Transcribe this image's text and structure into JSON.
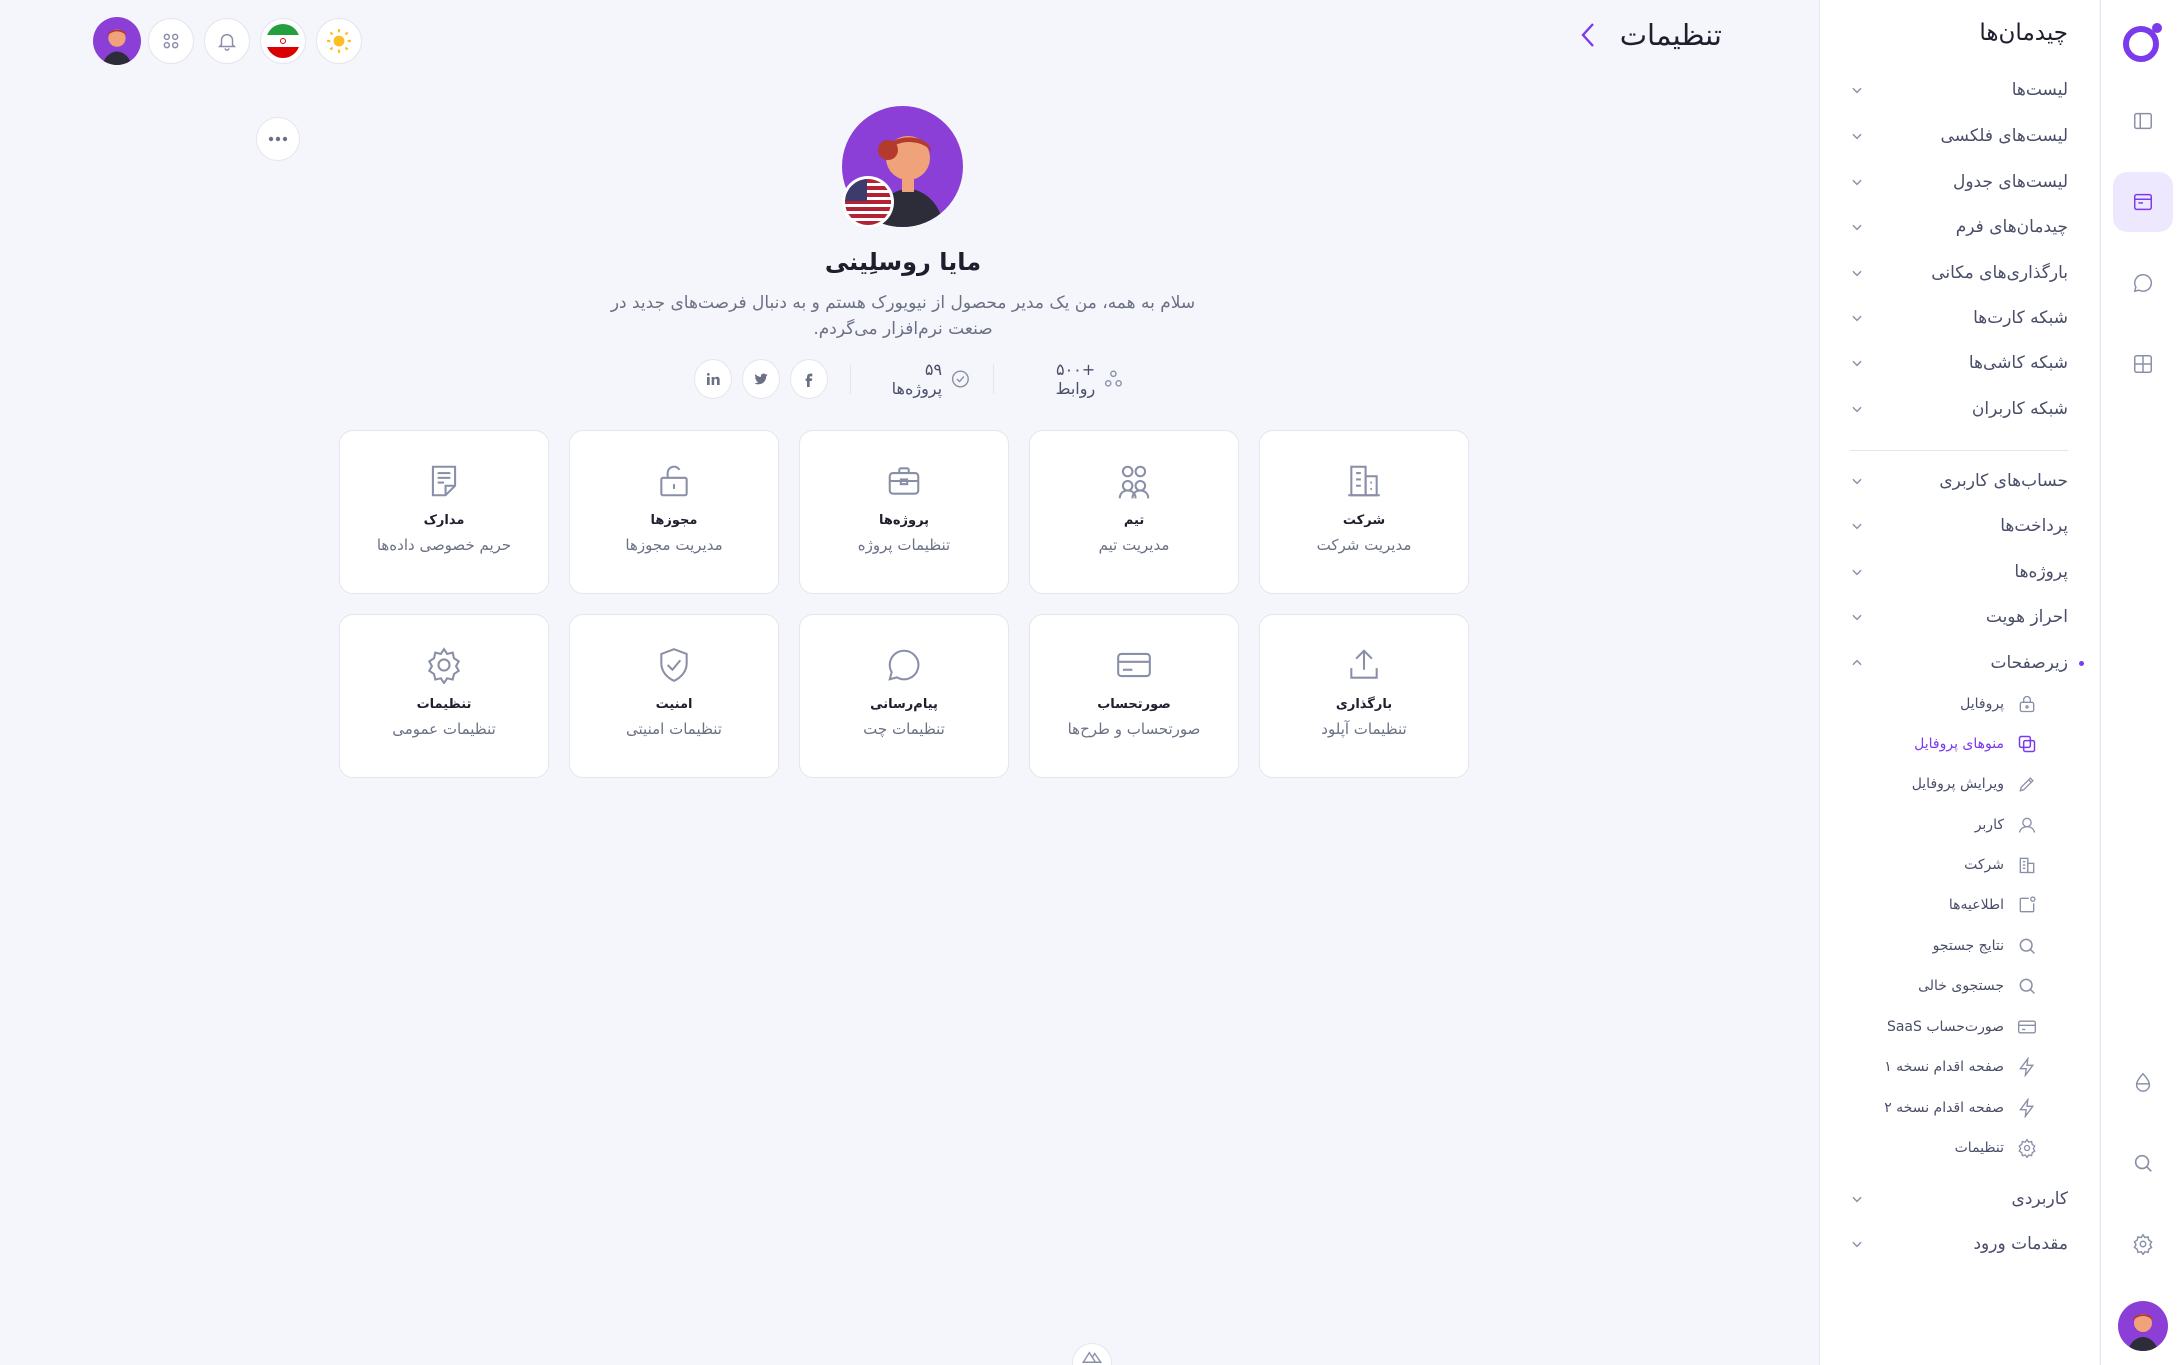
{
  "header": {
    "title": "تنظیمات",
    "back_icon": "chevron-left-icon",
    "actions": [
      "sun-icon",
      "iran-flag",
      "bell-icon",
      "apps-icon",
      "user-avatar"
    ]
  },
  "profile": {
    "name": "مایا روسلِینی",
    "bio": "سلام به همه، من یک مدیر محصول از نیویورک هستم و به دنبال فرصت‌های جدید در صنعت نرم‌افزار می‌گردم.",
    "connections": "+۵۰۰ روابط",
    "projects": "۵۹ پروژه‌ها",
    "social": [
      "linkedin-icon",
      "twitter-icon",
      "facebook-icon"
    ]
  },
  "cards": [
    {
      "title": "شرکت",
      "subtitle": "مدیریت شرکت",
      "icon": "building-icon"
    },
    {
      "title": "تیم",
      "subtitle": "مدیریت تیم",
      "icon": "team-icon"
    },
    {
      "title": "پروژه‌ها",
      "subtitle": "تنظیمات پروژه",
      "icon": "briefcase-icon"
    },
    {
      "title": "مجوزها",
      "subtitle": "مدیریت مجوزها",
      "icon": "unlock-icon"
    },
    {
      "title": "مدارک",
      "subtitle": "حریم خصوصی داده‌ها",
      "icon": "document-icon"
    },
    {
      "title": "بارگذاری",
      "subtitle": "تنظیمات آپلود",
      "icon": "upload-icon"
    },
    {
      "title": "صورتحساب",
      "subtitle": "صورتحساب و طرح‌ها",
      "icon": "credit-card-icon"
    },
    {
      "title": "پیام‌رسانی",
      "subtitle": "تنظیمات چت",
      "icon": "chat-icon"
    },
    {
      "title": "امنیت",
      "subtitle": "تنظیمات امنیتی",
      "icon": "shield-icon"
    },
    {
      "title": "تنظیمات",
      "subtitle": "تنظیمات عمومی",
      "icon": "gear-icon"
    }
  ],
  "sidebar": {
    "title": "چیدمان‌ها",
    "groups": [
      "لیست‌ها",
      "لیست‌های فلکسی",
      "لیست‌های جدول",
      "چیدمان‌های فرم",
      "بارگذاری‌های مکانی",
      "شبکه کارت‌ها",
      "شبکه کاشی‌ها",
      "شبکه کاربران"
    ],
    "sections": [
      "حساب‌های کاربری",
      "پرداخت‌ها",
      "پروژه‌ها",
      "احراز هویت",
      "زیرصفحات"
    ],
    "subpages": [
      {
        "label": "پروفایل",
        "icon": "lock-icon"
      },
      {
        "label": "منوهای پروفایل",
        "icon": "copy-icon",
        "active": true
      },
      {
        "label": "ویرایش پروفایل",
        "icon": "pencil-icon"
      },
      {
        "label": "کاربر",
        "icon": "user-icon"
      },
      {
        "label": "شرکت",
        "icon": "building-icon"
      },
      {
        "label": "اطلاعیه‌ها",
        "icon": "notification-icon"
      },
      {
        "label": "نتایج جستجو",
        "icon": "search-icon"
      },
      {
        "label": "جستجوی خالی",
        "icon": "search-icon"
      },
      {
        "label": "صورت‌حساب SaaS",
        "icon": "credit-card-icon"
      },
      {
        "label": "صفحه اقدام نسخه ۱",
        "icon": "bolt-icon"
      },
      {
        "label": "صفحه اقدام نسخه ۲",
        "icon": "bolt-icon"
      },
      {
        "label": "تنظیمات",
        "icon": "gear-icon"
      }
    ],
    "bottom": [
      "کاربردی",
      "مقدمات ورود"
    ]
  },
  "colors": {
    "accent": "#7c3aed",
    "background": "#f4f6fb",
    "card": "#ffffff",
    "muted": "#6b7085",
    "icon": "#8a8fa8"
  }
}
